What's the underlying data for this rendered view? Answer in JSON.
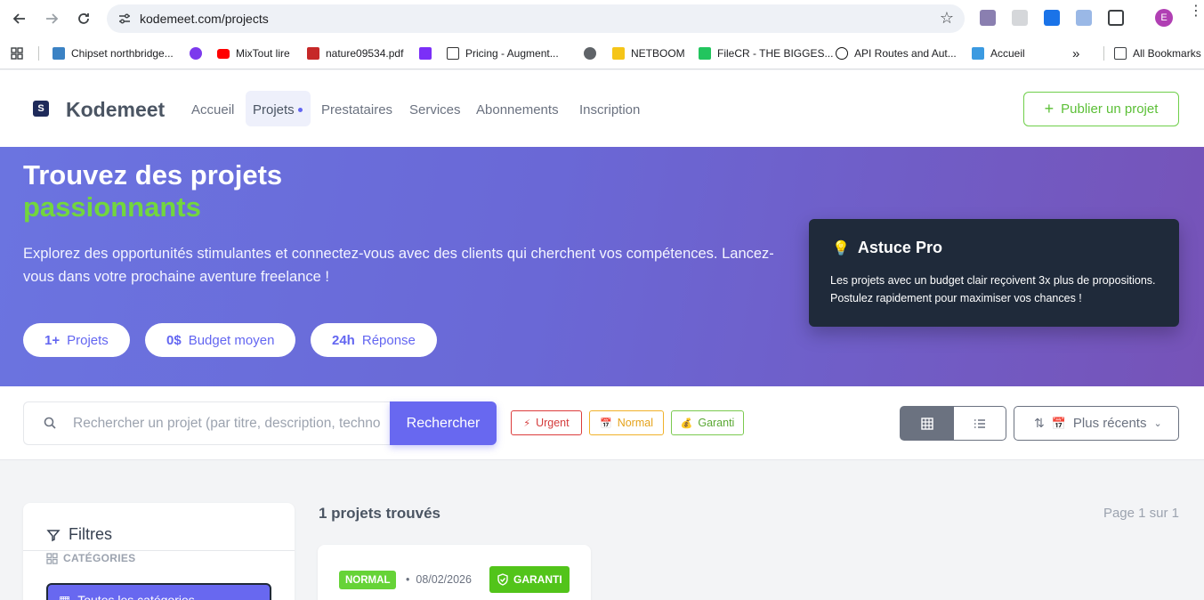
{
  "browser": {
    "url": "kodemeet.com/projects",
    "avatar_letter": "E",
    "bookmarks": [
      {
        "label": "Chipset northbridge...",
        "icon": "chipset-icon",
        "color": "#3b82c4"
      },
      {
        "label": "",
        "icon": "swirl-icon",
        "color": "#7c3aed"
      },
      {
        "label": "MixTout lire",
        "icon": "youtube-icon",
        "color": "#ff0000"
      },
      {
        "label": "nature09534.pdf",
        "icon": "pdf-icon",
        "color": "#c62828"
      },
      {
        "label": "",
        "icon": "bootstrap-icon",
        "color": "#7b2ff7"
      },
      {
        "label": "Pricing - Augment...",
        "icon": "augment-icon",
        "color": "#333333"
      },
      {
        "label": "",
        "icon": "globe-icon",
        "color": "#5f6368"
      },
      {
        "label": "NETBOOM",
        "icon": "netboom-icon",
        "color": "#f5c518"
      },
      {
        "label": "FileCR - THE BIGGES...",
        "icon": "filecr-icon",
        "color": "#22c55e"
      },
      {
        "label": "API Routes and Aut...",
        "icon": "api-icon",
        "color": "#111111"
      },
      {
        "label": "Accueil",
        "icon": "accueil-icon",
        "color": "#3b9ae1"
      },
      {
        "label": "All Bookmarks",
        "icon": "folder-icon",
        "color": "#5f6368"
      }
    ]
  },
  "header": {
    "logo_text": "Kodemeet",
    "logo_mark": "S",
    "nav": [
      {
        "label": "Accueil"
      },
      {
        "label": "Projets",
        "active": true
      },
      {
        "label": "Prestataires"
      },
      {
        "label": "Services"
      },
      {
        "label": "Abonnements"
      },
      {
        "label": "Inscription"
      }
    ],
    "publish_label": "Publier un projet"
  },
  "hero": {
    "title_line1": "Trouvez des projets",
    "title_line2": "passionnants",
    "description": "Explorez des opportunités stimulantes et connectez-vous avec des clients qui cherchent vos compétences. Lancez-vous dans votre prochaine aventure freelance !",
    "stats": [
      {
        "value": "1+",
        "label": "Projets"
      },
      {
        "value": "0$",
        "label": "Budget moyen"
      },
      {
        "value": "24h",
        "label": "Réponse"
      }
    ],
    "tip": {
      "title": "Astuce Pro",
      "text": "Les projets avec un budget clair reçoivent 3x plus de propositions. Postulez rapidement pour maximiser vos chances !"
    }
  },
  "search": {
    "placeholder": "Rechercher un projet (par titre, description, technologie...)",
    "value": "",
    "button_label": "Rechercher",
    "tags": [
      {
        "label": "Urgent",
        "icon": "lightning-icon"
      },
      {
        "label": "Normal",
        "icon": "calendar-icon"
      },
      {
        "label": "Garanti",
        "icon": "money-bag-icon"
      }
    ],
    "sort_label": "Plus récents"
  },
  "filters": {
    "title": "Filtres",
    "section_label": "CATÉGORIES",
    "all_categories_label": "Toutes les catégories"
  },
  "results": {
    "count_label": "1 projets trouvés",
    "page_label": "Page 1 sur 1"
  },
  "project_card": {
    "priority_badge": "NORMAL",
    "date": "08/02/2026",
    "guarantee_badge": "GARANTI"
  },
  "colors": {
    "accent": "#6868f0",
    "green": "#72d63e",
    "tip_bg": "#1f2a3a"
  }
}
